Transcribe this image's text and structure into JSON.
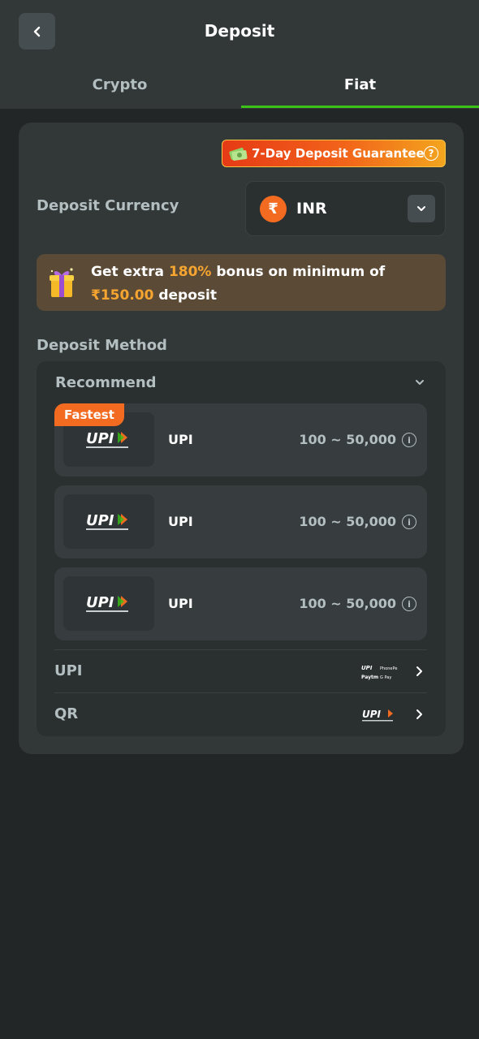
{
  "header": {
    "title": "Deposit"
  },
  "tabs": [
    {
      "label": "Crypto",
      "active": false
    },
    {
      "label": "Fiat",
      "active": true
    }
  ],
  "guarantee": {
    "label": "7-Day Deposit Guarantee",
    "icon": "money-bag-icon"
  },
  "currency": {
    "label": "Deposit Currency",
    "symbol": "₹",
    "code": "INR"
  },
  "bonus": {
    "prefix": "Get extra ",
    "percent": "180%",
    "middle": " bonus on minimum of ",
    "amount": "₹150.00",
    "suffix": " deposit"
  },
  "method": {
    "label": "Deposit Method",
    "recommend_label": "Recommend",
    "items": [
      {
        "badge": "Fastest",
        "name": "UPI",
        "range": "100 ~ 50,000"
      },
      {
        "badge": "",
        "name": "UPI",
        "range": "100 ~ 50,000"
      },
      {
        "badge": "",
        "name": "UPI",
        "range": "100 ~ 50,000"
      }
    ],
    "categories": [
      {
        "label": "UPI"
      },
      {
        "label": "QR"
      }
    ]
  },
  "colors": {
    "accent": "#3bc117",
    "orange": "#f36b21",
    "highlight": "#f7a531",
    "background": "#232626",
    "panel": "#323738"
  }
}
